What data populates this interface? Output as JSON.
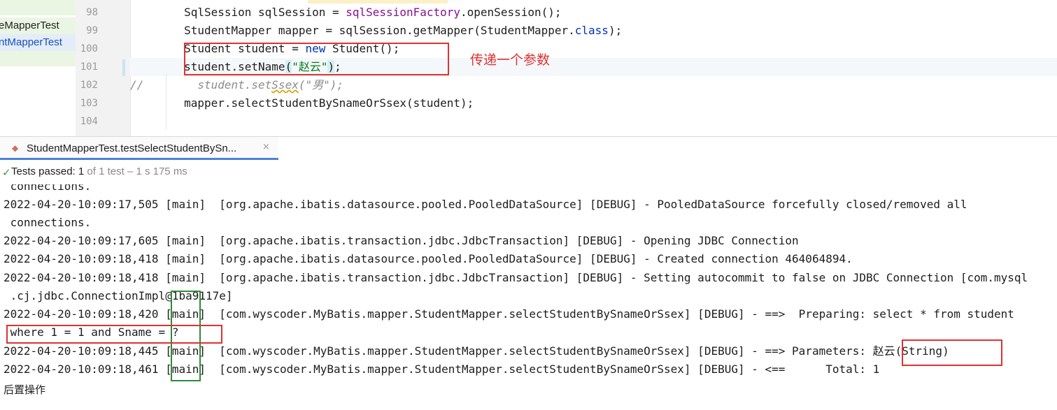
{
  "project": {
    "items": [
      "eMapperTest",
      "ntMapperTest"
    ]
  },
  "editor": {
    "line_numbers": [
      "98",
      "99",
      "100",
      "101",
      "102",
      "103",
      "104"
    ],
    "lines": {
      "l98_a": "        SqlSession sqlSession = ",
      "l98_b": "sqlSessionFactory",
      "l98_c": ".openSession();",
      "l99_a": "        StudentMapper mapper = sqlSession.getMapper(StudentMapper.",
      "l99_b": "class",
      "l99_c": ");",
      "l100_a": "        Student student = ",
      "l100_b": "new",
      "l100_c": " Student();",
      "l101_a": "        student.setName",
      "l101_b": "(",
      "l101_c": "\"赵云\"",
      "l101_d": ")",
      "l101_e": ";",
      "l102_a": "//        student.set",
      "l102_b": "Ssex",
      "l102_c": "(\"男\");",
      "l103": "        mapper.selectStudentBySnameOrSsex(student);"
    },
    "annotation": "传递一个参数"
  },
  "run": {
    "tab_label": "StudentMapperTest.testSelectStudentBySn...",
    "close_glyph": "×",
    "status_label": "Tests passed: ",
    "status_count": "1",
    "status_rest": " of 1 test – 1 s 175 ms"
  },
  "console": {
    "lines": [
      " connections.",
      "2022-04-20-10:09:17,505 [main]  [org.apache.ibatis.datasource.pooled.PooledDataSource] [DEBUG] - PooledDataSource forcefully closed/removed all",
      " connections.",
      "2022-04-20-10:09:17,605 [main]  [org.apache.ibatis.transaction.jdbc.JdbcTransaction] [DEBUG] - Opening JDBC Connection",
      "2022-04-20-10:09:18,418 [main]  [org.apache.ibatis.datasource.pooled.PooledDataSource] [DEBUG] - Created connection 464064894.",
      "2022-04-20-10:09:18,418 [main]  [org.apache.ibatis.transaction.jdbc.JdbcTransaction] [DEBUG] - Setting autocommit to false on JDBC Connection [com.mysql",
      " .cj.jdbc.ConnectionImpl@1ba9117e]",
      "2022-04-20-10:09:18,420 [main]  [com.wyscoder.MyBatis.mapper.StudentMapper.selectStudentBySnameOrSsex] [DEBUG] - ==>  Preparing: select * from student",
      " where 1 = 1 and Sname = ?",
      "2022-04-20-10:09:18,445 [main]  [com.wyscoder.MyBatis.mapper.StudentMapper.selectStudentBySnameOrSsex] [DEBUG] - ==> Parameters: 赵云(String)",
      "2022-04-20-10:09:18,461 [main]  [com.wyscoder.MyBatis.mapper.StudentMapper.selectStudentBySnameOrSsex] [DEBUG] - <==      Total: 1"
    ],
    "after_op": "后置操作"
  },
  "colors": {
    "annotation_red": "#e03131",
    "annotation_green": "#2e8b3a",
    "keyword": "#0033b3",
    "field": "#871094",
    "string": "#067d17"
  }
}
